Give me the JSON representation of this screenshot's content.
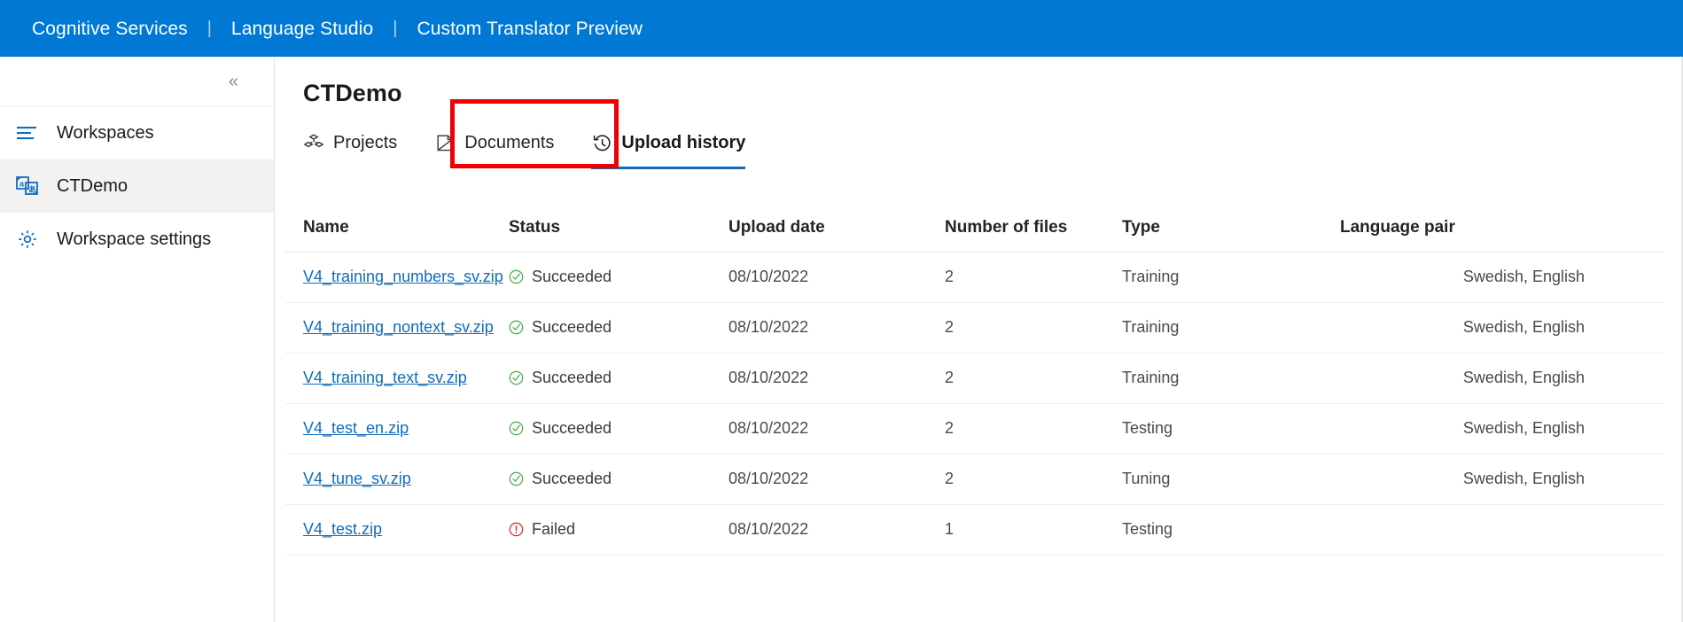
{
  "topbar": {
    "breadcrumb": [
      {
        "label": "Cognitive Services",
        "icon": "none"
      },
      {
        "label": "Language Studio",
        "icon": "none"
      },
      {
        "label": "Custom Translator Preview",
        "icon": "none"
      }
    ],
    "separator": "|",
    "background_color": "#0078d4",
    "text_color": "#ffffff"
  },
  "sidebar": {
    "collapse_icon": "chevron-double-left-icon",
    "collapse_glyph": "«",
    "items": [
      {
        "label": "Workspaces",
        "icon": "list-lines-icon",
        "selected": false
      },
      {
        "label": "CTDemo",
        "icon": "translate-language-icon",
        "selected": true
      },
      {
        "label": "Workspace settings",
        "icon": "gear-icon",
        "selected": false
      }
    ]
  },
  "main": {
    "title": "CTDemo",
    "tabs": [
      {
        "label": "Projects",
        "icon": "projects-cubes-icon",
        "active": false
      },
      {
        "label": "Documents",
        "icon": "document-icon",
        "active": false
      },
      {
        "label": "Upload history",
        "icon": "history-clock-icon",
        "active": true
      }
    ],
    "active_tab_underline_color": "#0f6cbd",
    "annotation_box_color": "#ee0000"
  },
  "table": {
    "columns": [
      "Name",
      "Status",
      "Upload date",
      "Number of files",
      "Type",
      "Language pair"
    ],
    "rows": [
      {
        "name": "V4_training_numbers_sv.zip",
        "status": "Succeeded",
        "status_icon": "check-circle-icon",
        "status_color": "#4caf50",
        "upload_date": "08/10/2022",
        "number_of_files": "2",
        "type": "Training",
        "language_pair": "Swedish, English"
      },
      {
        "name": "V4_training_nontext_sv.zip",
        "status": "Succeeded",
        "status_icon": "check-circle-icon",
        "status_color": "#4caf50",
        "upload_date": "08/10/2022",
        "number_of_files": "2",
        "type": "Training",
        "language_pair": "Swedish, English"
      },
      {
        "name": "V4_training_text_sv.zip",
        "status": "Succeeded",
        "status_icon": "check-circle-icon",
        "status_color": "#4caf50",
        "upload_date": "08/10/2022",
        "number_of_files": "2",
        "type": "Training",
        "language_pair": "Swedish, English"
      },
      {
        "name": "V4_test_en.zip",
        "status": "Succeeded",
        "status_icon": "check-circle-icon",
        "status_color": "#4caf50",
        "upload_date": "08/10/2022",
        "number_of_files": "2",
        "type": "Testing",
        "language_pair": "Swedish, English"
      },
      {
        "name": "V4_tune_sv.zip",
        "status": "Succeeded",
        "status_icon": "check-circle-icon",
        "status_color": "#4caf50",
        "upload_date": "08/10/2022",
        "number_of_files": "2",
        "type": "Tuning",
        "language_pair": "Swedish, English"
      },
      {
        "name": "V4_test.zip",
        "status": "Failed",
        "status_icon": "error-circle-icon",
        "status_color": "#d13438",
        "upload_date": "08/10/2022",
        "number_of_files": "1",
        "type": "Testing",
        "language_pair": ""
      }
    ]
  }
}
